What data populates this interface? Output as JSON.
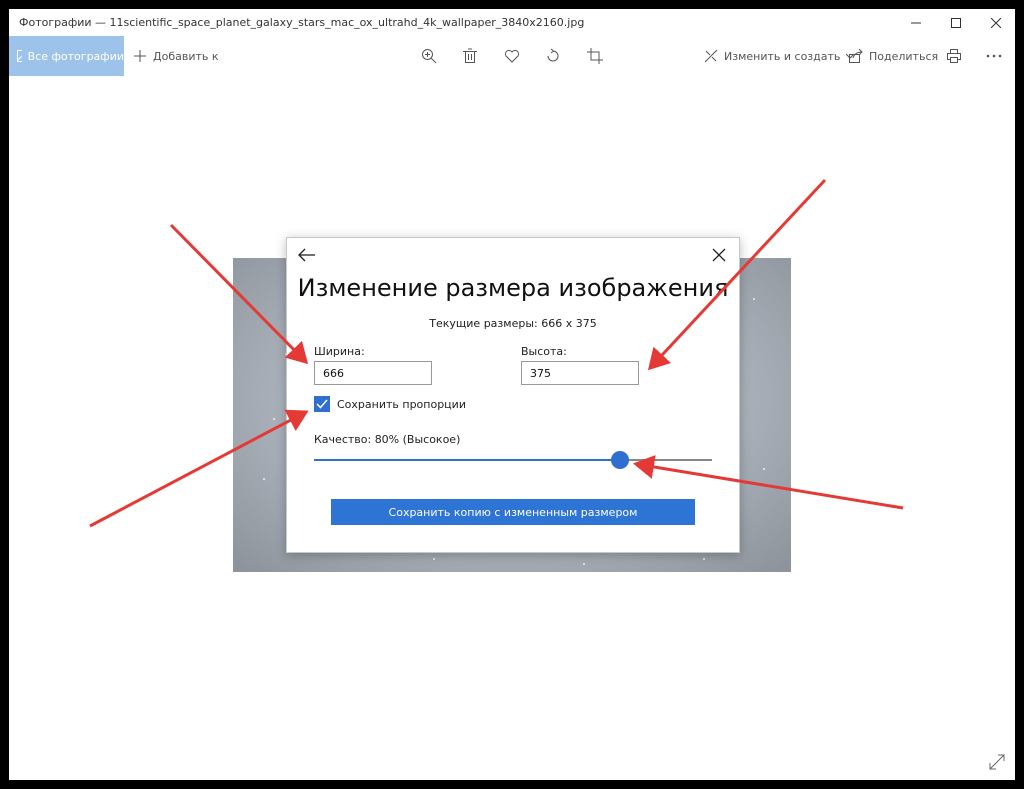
{
  "window": {
    "title": "Фотографии — 11scientific_space_planet_galaxy_stars_mac_ox_ultrahd_4k_wallpaper_3840x2160.jpg",
    "controls": [
      "minimize-icon",
      "maximize-icon",
      "close-icon"
    ]
  },
  "toolbar": {
    "all_photos": "Все фотографии",
    "add_to": "Добавить к",
    "edit_create": "Изменить и создать",
    "share": "Поделиться",
    "icons": [
      "zoom-icon",
      "delete-icon",
      "heart-icon",
      "rotate-icon",
      "crop-icon",
      "print-icon",
      "more-icon"
    ]
  },
  "dialog": {
    "title": "Изменение размера изображения",
    "current_size": "Текущие размеры: 666 x 375",
    "width_label": "Ширина:",
    "width_value": "666",
    "height_label": "Высота:",
    "height_value": "375",
    "keep_ratio_label": "Сохранить пропорции",
    "keep_ratio_checked": true,
    "quality_label": "Качество: 80% (Высокое)",
    "quality_percent": 80,
    "save_button": "Сохранить копию с измененным размером"
  },
  "colors": {
    "accent": "#2e74d5",
    "annotation_arrow": "#e53935",
    "toolbar_selected": "#9dc3ea"
  }
}
